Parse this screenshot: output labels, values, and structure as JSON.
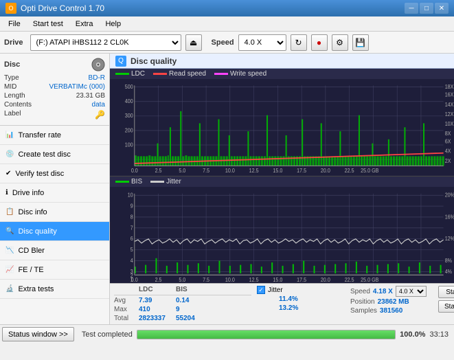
{
  "titleBar": {
    "title": "Opti Drive Control 1.70",
    "minBtn": "─",
    "maxBtn": "□",
    "closeBtn": "✕"
  },
  "menuBar": {
    "items": [
      "File",
      "Start test",
      "Extra",
      "Help"
    ]
  },
  "toolbar": {
    "driveLabel": "Drive",
    "driveValue": "(F:)  ATAPI iHBS112  2 CL0K",
    "speedLabel": "Speed",
    "speedValue": "4.0 X"
  },
  "disc": {
    "title": "Disc",
    "typeLabel": "Type",
    "typeValue": "BD-R",
    "midLabel": "MID",
    "midValue": "VERBATIMc (000)",
    "lengthLabel": "Length",
    "lengthValue": "23.31 GB",
    "contentsLabel": "Contents",
    "contentsValue": "data",
    "labelLabel": "Label",
    "labelValue": ""
  },
  "navItems": [
    {
      "label": "Transfer rate",
      "icon": "📊",
      "active": false
    },
    {
      "label": "Create test disc",
      "icon": "💿",
      "active": false
    },
    {
      "label": "Verify test disc",
      "icon": "✔",
      "active": false
    },
    {
      "label": "Drive info",
      "icon": "ℹ",
      "active": false
    },
    {
      "label": "Disc info",
      "icon": "📋",
      "active": false
    },
    {
      "label": "Disc quality",
      "icon": "🔍",
      "active": true
    },
    {
      "label": "CD Bler",
      "icon": "📉",
      "active": false
    },
    {
      "label": "FE / TE",
      "icon": "📈",
      "active": false
    },
    {
      "label": "Extra tests",
      "icon": "🔬",
      "active": false
    }
  ],
  "chartTitle": "Disc quality",
  "legend1": {
    "items": [
      {
        "label": "LDC",
        "color": "#00aa00"
      },
      {
        "label": "Read speed",
        "color": "#ff4444"
      },
      {
        "label": "Write speed",
        "color": "#ff44ff"
      }
    ]
  },
  "legend2": {
    "items": [
      {
        "label": "BIS",
        "color": "#00cc00"
      },
      {
        "label": "Jitter",
        "color": "#ffffff"
      }
    ]
  },
  "stats": {
    "headers": [
      "LDC",
      "BIS",
      "",
      "Jitter",
      "Speed"
    ],
    "avgLabel": "Avg",
    "avgLDC": "7.39",
    "avgBIS": "0.14",
    "avgJitter": "11.4%",
    "avgSpeed": "4.18 X",
    "maxLabel": "Max",
    "maxLDC": "410",
    "maxBIS": "9",
    "maxJitter": "13.2%",
    "speedSelect": "4.0 X",
    "totalLabel": "Total",
    "totalLDC": "2823337",
    "totalBIS": "55204",
    "positionLabel": "Position",
    "positionValue": "23862 MB",
    "samplesLabel": "Samples",
    "samplesValue": "381560",
    "startFullBtn": "Start full",
    "startPartBtn": "Start part"
  },
  "statusBar": {
    "statusWindowBtn": "Status window >>",
    "progressPct": "100.0%",
    "time": "33:13",
    "statusText": "Test completed"
  }
}
